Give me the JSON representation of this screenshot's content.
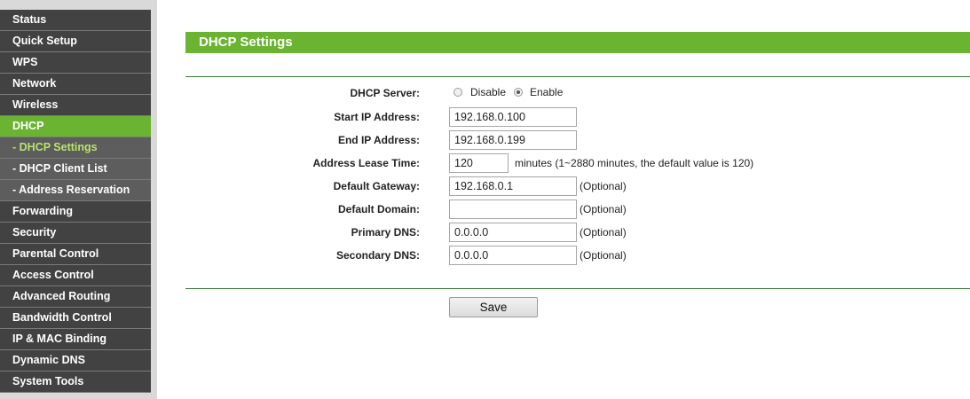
{
  "sidebar": {
    "items": [
      {
        "label": "Status"
      },
      {
        "label": "Quick Setup"
      },
      {
        "label": "WPS"
      },
      {
        "label": "Network"
      },
      {
        "label": "Wireless"
      },
      {
        "label": "DHCP"
      },
      {
        "label": "- DHCP Settings"
      },
      {
        "label": "- DHCP Client List"
      },
      {
        "label": "- Address Reservation"
      },
      {
        "label": "Forwarding"
      },
      {
        "label": "Security"
      },
      {
        "label": "Parental Control"
      },
      {
        "label": "Access Control"
      },
      {
        "label": "Advanced Routing"
      },
      {
        "label": "Bandwidth Control"
      },
      {
        "label": "IP & MAC Binding"
      },
      {
        "label": "Dynamic DNS"
      },
      {
        "label": "System Tools"
      }
    ]
  },
  "page": {
    "title": "DHCP Settings"
  },
  "form": {
    "dhcp_server": {
      "label": "DHCP Server:",
      "options": [
        "Disable",
        "Enable"
      ],
      "selected": "Enable"
    },
    "start_ip": {
      "label": "Start IP Address:",
      "value": "192.168.0.100"
    },
    "end_ip": {
      "label": "End IP Address:",
      "value": "192.168.0.199"
    },
    "lease_time": {
      "label": "Address Lease Time:",
      "value": "120",
      "note": "minutes (1~2880 minutes, the default value is 120)"
    },
    "gateway": {
      "label": "Default Gateway:",
      "value": "192.168.0.1",
      "note": "(Optional)"
    },
    "domain": {
      "label": "Default Domain:",
      "value": "",
      "note": "(Optional)"
    },
    "primary_dns": {
      "label": "Primary DNS:",
      "value": "0.0.0.0",
      "note": "(Optional)"
    },
    "secondary_dns": {
      "label": "Secondary DNS:",
      "value": "0.0.0.0",
      "note": "(Optional)"
    }
  },
  "actions": {
    "save_label": "Save"
  },
  "colors": {
    "accent_green": "#6ab431",
    "menu_dark": "#424242",
    "submenu": "#5d5d5d",
    "submenu_current_text": "#b9e36a",
    "rule_green": "#3b7a3b"
  }
}
